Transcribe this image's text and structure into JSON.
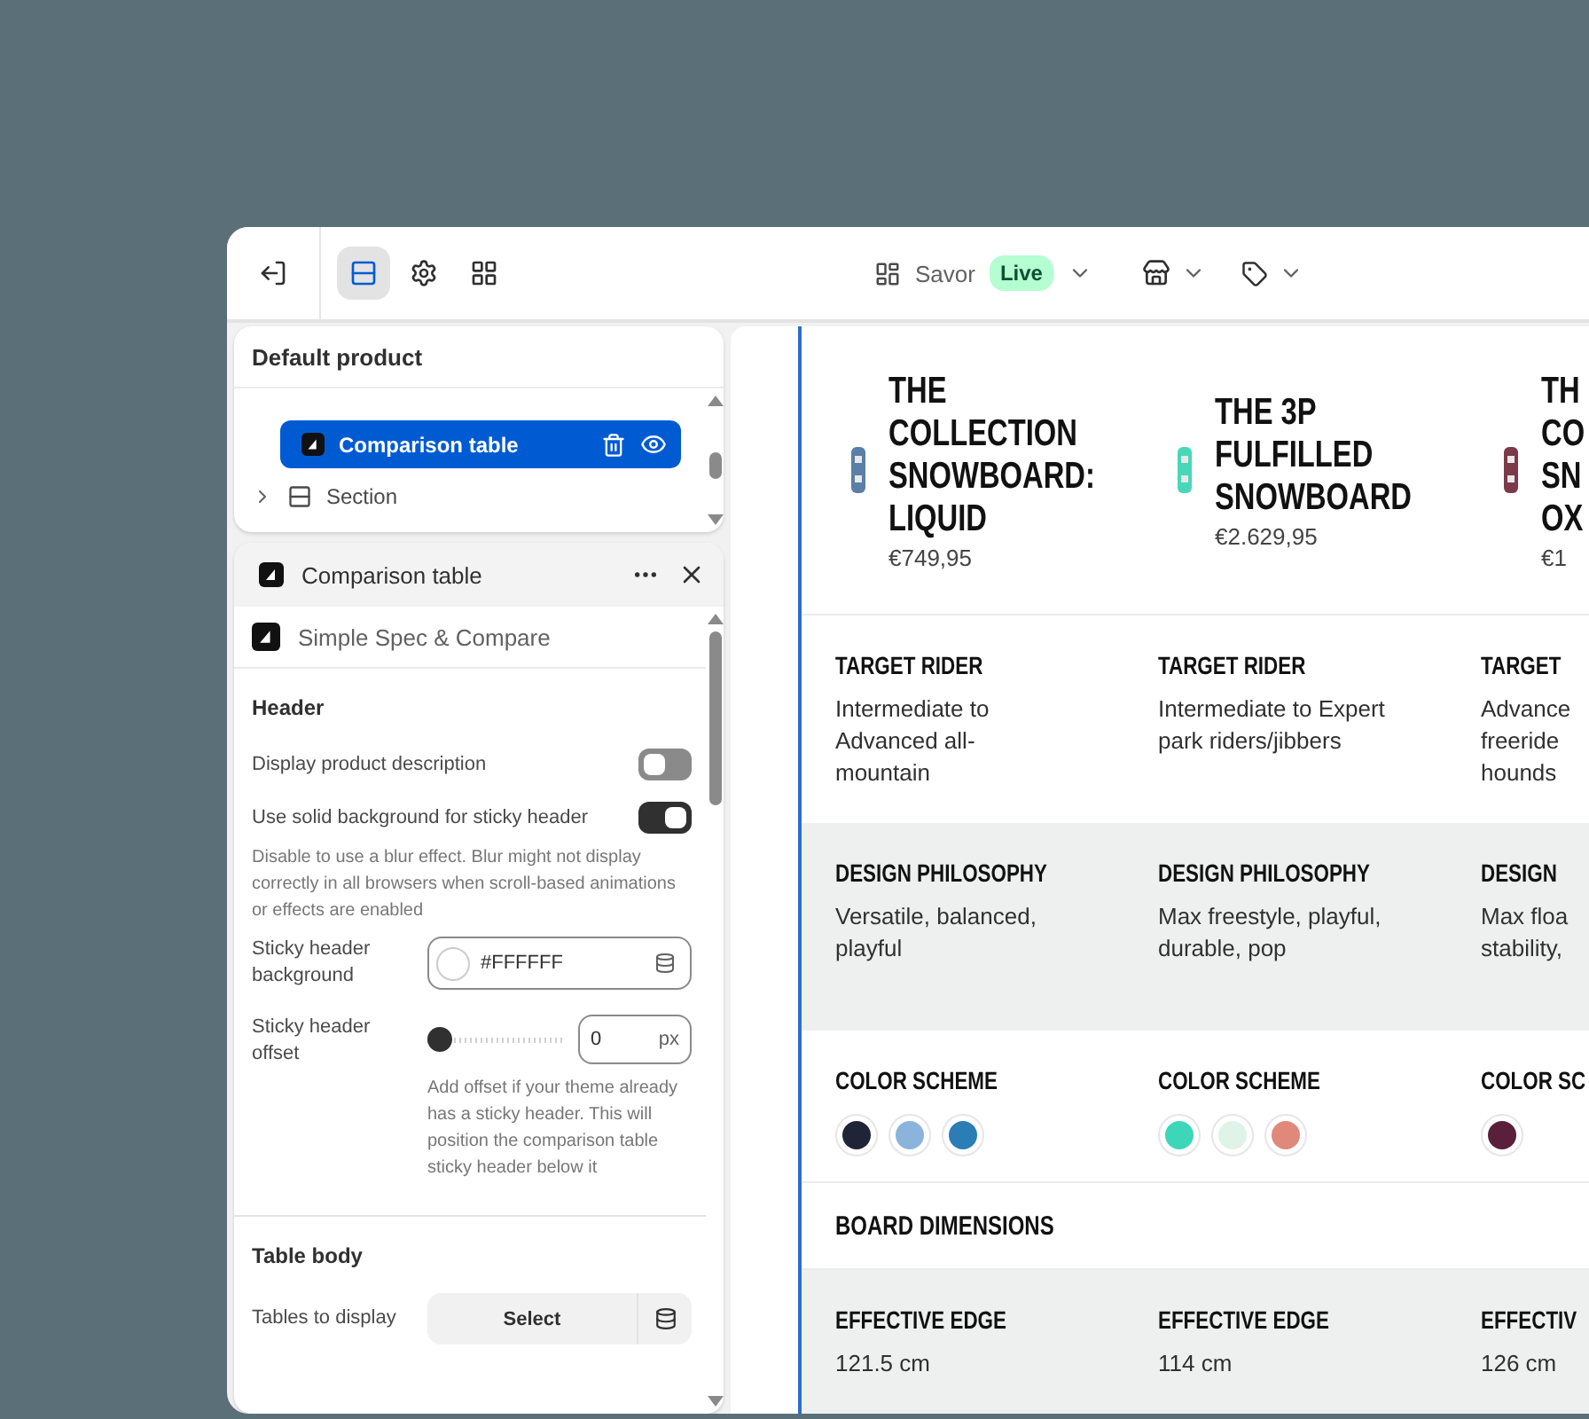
{
  "toolbar": {
    "theme_name": "Savor",
    "status_badge": "Live"
  },
  "tree_panel": {
    "title": "Default product",
    "items": [
      {
        "kind": "block",
        "label": "Comparison table",
        "selected": true
      },
      {
        "kind": "section",
        "label": "Section",
        "selected": false
      }
    ]
  },
  "settings_panel": {
    "title": "Comparison table",
    "app_name": "Simple Spec & Compare",
    "sections": [
      {
        "heading": "Header",
        "settings": [
          {
            "kind": "toggle",
            "label": "Display product description",
            "on": false
          },
          {
            "kind": "toggle",
            "label": "Use solid background for sticky header",
            "on": true,
            "hint": "Disable to use a blur effect. Blur might not display correctly in all browsers when scroll-based animations or effects are enabled"
          },
          {
            "kind": "color",
            "label": "Sticky header background",
            "value": "#FFFFFF"
          },
          {
            "kind": "range",
            "label": "Sticky header offset",
            "level": 0,
            "value": "0",
            "unit": "px",
            "hint": "Add offset if your theme already has a sticky header. This will position the comparison table sticky header below it"
          }
        ]
      },
      {
        "heading": "Table body",
        "settings": [
          {
            "kind": "select",
            "label": "Tables to display",
            "value": "Select"
          }
        ]
      }
    ]
  },
  "comparison": {
    "products": [
      {
        "name_lines": [
          "THE",
          "COLLECTION",
          "SNOWBOARD:",
          "LIQUID"
        ],
        "price": "€749,95",
        "color": "#5b7fa6"
      },
      {
        "name_lines": [
          "THE 3P",
          "FULFILLED",
          "SNOWBOARD"
        ],
        "price": "€2.629,95",
        "color": "#48d8b8"
      },
      {
        "name_lines": [
          "TH",
          "CO",
          "SN",
          "OX"
        ],
        "price": "€1",
        "color": "#7a3a4a"
      }
    ],
    "rows": [
      {
        "kind": "text",
        "shaded": false,
        "cells": [
          {
            "heading": "TARGET RIDER",
            "lines": [
              "Intermediate to",
              "Advanced all-",
              "mountain"
            ]
          },
          {
            "heading": "TARGET RIDER",
            "lines": [
              "Intermediate to Expert",
              "park riders/jibbers"
            ]
          },
          {
            "heading": "TARGET",
            "lines": [
              "Advance",
              "freeride",
              "hounds"
            ]
          }
        ]
      },
      {
        "kind": "text",
        "shaded": true,
        "cells": [
          {
            "heading": "DESIGN PHILOSOPHY",
            "lines": [
              "Versatile, balanced,",
              "playful"
            ]
          },
          {
            "heading": "DESIGN PHILOSOPHY",
            "lines": [
              "Max freestyle, playful,",
              "durable, pop"
            ]
          },
          {
            "heading": "DESIGN",
            "lines": [
              "Max floa",
              "stability,"
            ]
          }
        ]
      },
      {
        "kind": "swatches",
        "shaded": false,
        "cells": [
          {
            "heading": "COLOR SCHEME",
            "swatches": [
              {
                "color": "#1f2437"
              },
              {
                "color": "#8ab4dc"
              },
              {
                "color": "#2a7db5"
              }
            ]
          },
          {
            "heading": "COLOR SCHEME",
            "swatches": [
              {
                "color": "#3dd6b8"
              },
              {
                "color": "#dff3e6"
              },
              {
                "color": "#e0897a"
              }
            ]
          },
          {
            "heading": "COLOR SC",
            "swatches": [
              {
                "color": "#5a1f3a"
              }
            ]
          }
        ]
      },
      {
        "kind": "group",
        "shaded": false,
        "title": "BOARD DIMENSIONS"
      },
      {
        "kind": "text",
        "shaded": true,
        "cells": [
          {
            "heading": "EFFECTIVE EDGE",
            "lines": [
              "121.5 cm"
            ]
          },
          {
            "heading": "EFFECTIVE EDGE",
            "lines": [
              "114 cm"
            ]
          },
          {
            "heading": "EFFECTIV",
            "lines": [
              "126 cm"
            ]
          }
        ]
      }
    ]
  }
}
